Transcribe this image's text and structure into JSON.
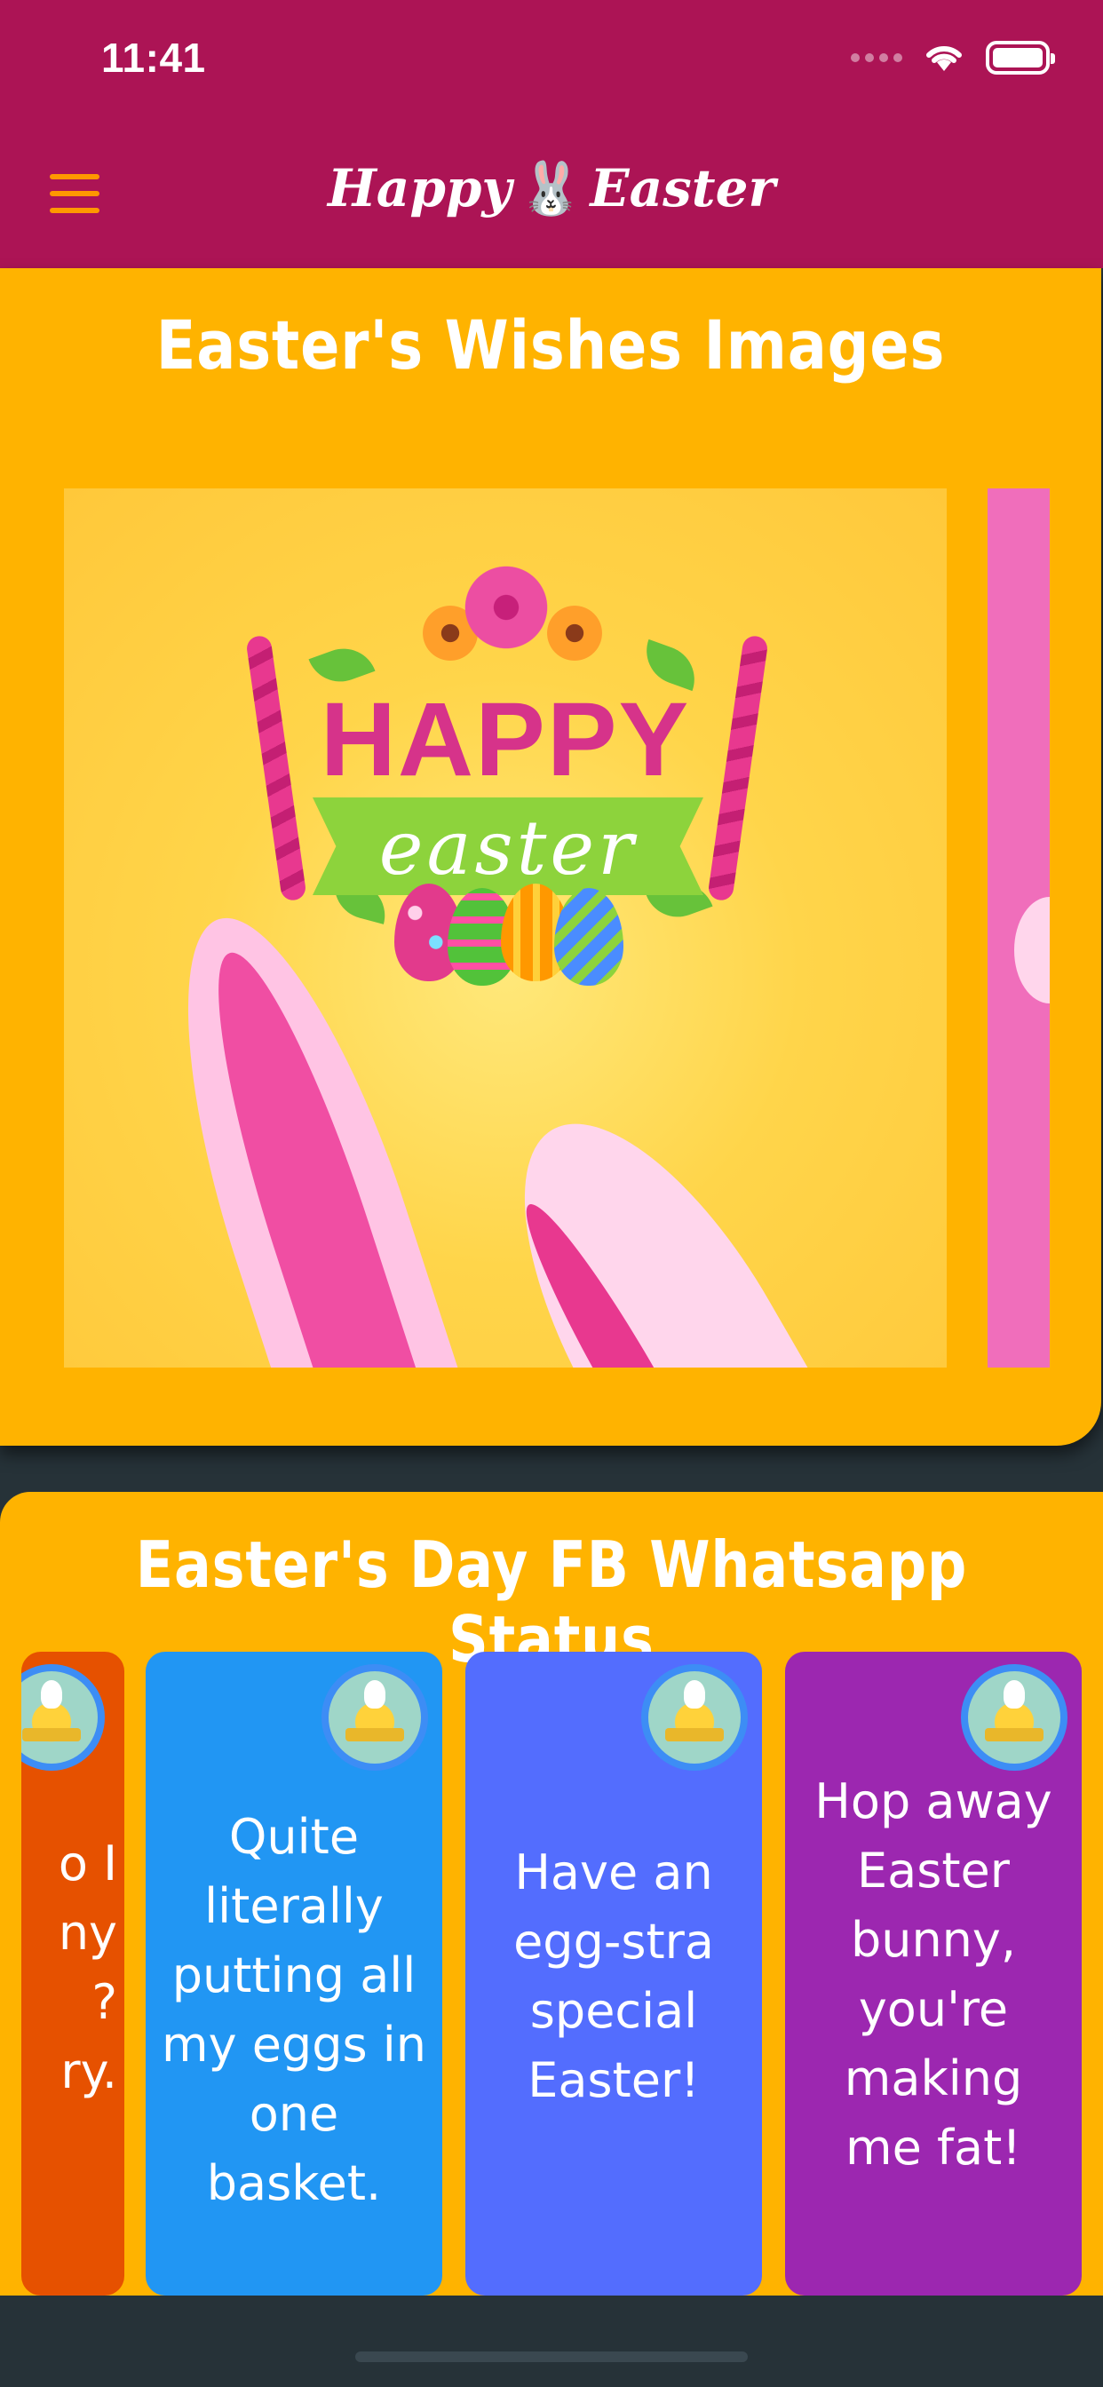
{
  "status_bar": {
    "time": "11:41"
  },
  "header": {
    "title_left": "Happy",
    "title_icon": "🐰",
    "title_right": "Easter"
  },
  "wishes": {
    "title": "Easter's Wishes Images",
    "image_text_happy": "HAPPY",
    "image_text_easter": "easter"
  },
  "status_section": {
    "title": "Easter's Day FB Whatsapp Status",
    "cards": [
      {
        "text": "o I\nny\n?\nry.",
        "color": "#e65100"
      },
      {
        "text": "Quite literally putting all my eggs in one basket.",
        "color": "#2196f3"
      },
      {
        "text": "Have an egg-stra special Easter!",
        "color": "#536dfe"
      },
      {
        "text": "Hop away Easter bunny, you're making me fat!",
        "color": "#9c27b0"
      }
    ]
  },
  "colors": {
    "topbar": "#ac1455",
    "card_bg": "#ffb300",
    "menu_icon": "#ff9800",
    "page_bg": "#263238"
  }
}
